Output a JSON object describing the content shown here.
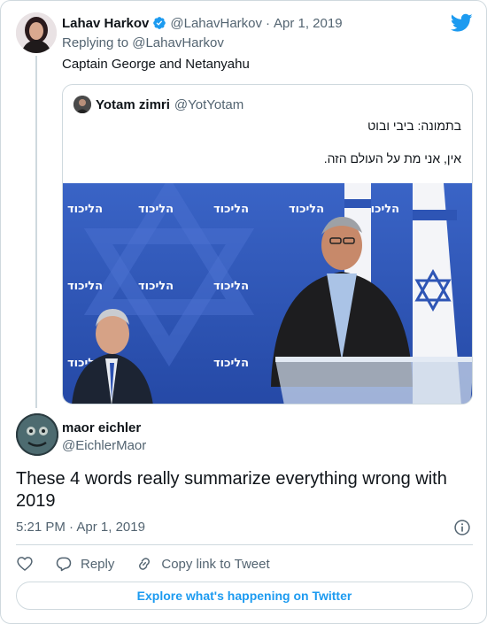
{
  "tweet": {
    "author_name": "Lahav Harkov",
    "author_handle": "@LahavHarkov",
    "separator": "·",
    "date": "Apr 1, 2019",
    "replying_prefix": "Replying to",
    "replying_handle": "@LahavHarkov",
    "text": "Captain George and Netanyahu",
    "icons": {
      "verified": "verified-badge-icon",
      "brand": "twitter-bird-icon"
    },
    "colors": {
      "brand_blue": "#1d9bf0",
      "muted": "#536471",
      "border": "#cfd9de"
    }
  },
  "quoted": {
    "author_name": "Yotam zimri",
    "author_handle": "@YotYotam",
    "line1": "בתמונה: ביבי ובוט",
    "line2": "אין, אני מת על העולם הזה.",
    "photo_text": "הליכוד",
    "photo_colors": {
      "backdrop": "#2e55b5",
      "logo_text": "#ffffff"
    }
  },
  "reply": {
    "author_name": "maor eichler",
    "author_handle": "@EichlerMaor",
    "text": "These 4 words really summarize everything wrong with 2019",
    "time": "5:21 PM",
    "separator": "·",
    "date": "Apr 1, 2019",
    "icons": {
      "info": "info-icon"
    }
  },
  "actions": {
    "like_icon": "heart-icon",
    "reply_label": "Reply",
    "reply_icon": "speech-bubble-icon",
    "copy_label": "Copy link to Tweet",
    "copy_icon": "link-icon"
  },
  "footer": {
    "explore_label": "Explore what's happening on Twitter"
  }
}
